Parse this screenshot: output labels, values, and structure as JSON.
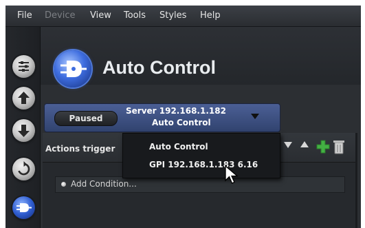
{
  "menu": {
    "items": [
      {
        "label": "File"
      },
      {
        "label": "Device"
      },
      {
        "label": "View"
      },
      {
        "label": "Tools"
      },
      {
        "label": "Styles"
      },
      {
        "label": "Help"
      }
    ]
  },
  "sidebar": {
    "items": [
      {
        "icon": "sliders-icon"
      },
      {
        "icon": "upload-arrow-icon"
      },
      {
        "icon": "download-arrow-icon"
      },
      {
        "icon": "refresh-icon"
      },
      {
        "icon": "auto-control-logo-icon"
      }
    ]
  },
  "header": {
    "title": "Auto Control",
    "logo_icon": "auto-control-logo-icon"
  },
  "server_bar": {
    "status": "Paused",
    "server_line": "Server 192.168.1.182",
    "profile": "Auto Control"
  },
  "panel": {
    "actions_label": "Actions trigger",
    "add_condition": "Add Condition..."
  },
  "dropdown": {
    "options": [
      {
        "label": "Auto Control"
      },
      {
        "label": "GPI 192.168.1.183 6.16"
      }
    ]
  },
  "colors": {
    "accent_blue": "#3e6ddf",
    "add_green": "#43b043",
    "menu_text": "#e6e6e6",
    "background": "#2c2f33"
  }
}
